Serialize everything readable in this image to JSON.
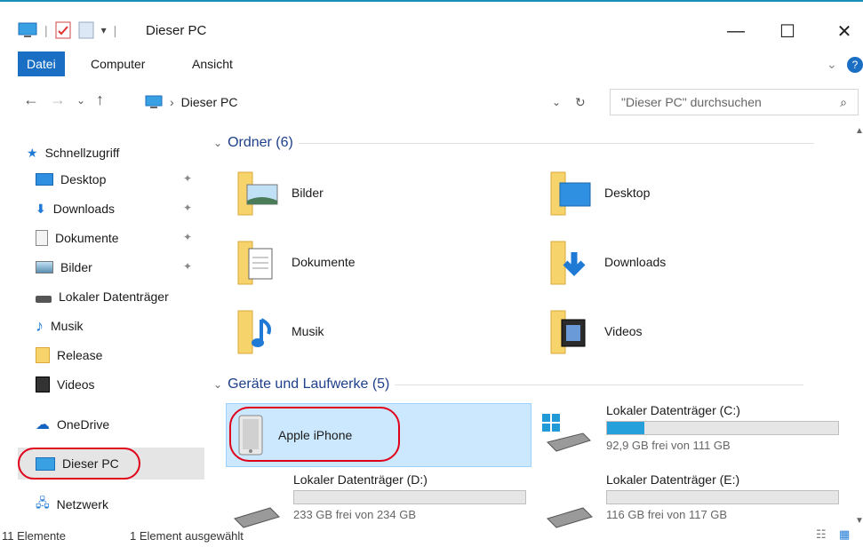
{
  "window": {
    "title": "Dieser PC"
  },
  "ribbon": {
    "tabs": [
      "Datei",
      "Computer",
      "Ansicht"
    ]
  },
  "address": {
    "path_label": "Dieser PC",
    "search_placeholder": "\"Dieser PC\" durchsuchen"
  },
  "sidebar": {
    "quick_access": "Schnellzugriff",
    "items": [
      {
        "label": "Desktop",
        "icon": "desktop-icon",
        "pinned": true
      },
      {
        "label": "Downloads",
        "icon": "downloads-icon",
        "pinned": true
      },
      {
        "label": "Dokumente",
        "icon": "documents-icon",
        "pinned": true
      },
      {
        "label": "Bilder",
        "icon": "pictures-icon",
        "pinned": true
      },
      {
        "label": "Lokaler Datenträger",
        "icon": "drive-icon",
        "pinned": false
      },
      {
        "label": "Musik",
        "icon": "music-icon",
        "pinned": false
      },
      {
        "label": "Release",
        "icon": "folder-icon",
        "pinned": false
      },
      {
        "label": "Videos",
        "icon": "videos-icon",
        "pinned": false
      }
    ],
    "onedrive": "OneDrive",
    "this_pc": "Dieser PC",
    "network": "Netzwerk"
  },
  "main": {
    "folders_header": "Ordner (6)",
    "folders": [
      "Bilder",
      "Desktop",
      "Dokumente",
      "Downloads",
      "Musik",
      "Videos"
    ],
    "devices_header": "Geräte und Laufwerke (5)",
    "devices": {
      "iphone": "Apple iPhone",
      "c": {
        "name": "Lokaler Datenträger (C:)",
        "free": "92,9 GB frei von 111 GB",
        "used_fraction": 0.16
      },
      "d": {
        "name": "Lokaler Datenträger (D:)",
        "free": "233 GB frei von 234 GB",
        "used_fraction": 0.0
      },
      "e": {
        "name": "Lokaler Datenträger (E:)",
        "free": "116 GB frei von 117 GB",
        "used_fraction": 0.0
      }
    }
  },
  "status": {
    "count": "11 Elemente",
    "selected": "1 Element ausgewählt"
  },
  "colors": {
    "accent": "#1a6fc4",
    "highlight_ring": "#e0001a",
    "selection": "#cce8ff",
    "bar_fill": "#26a0da"
  }
}
